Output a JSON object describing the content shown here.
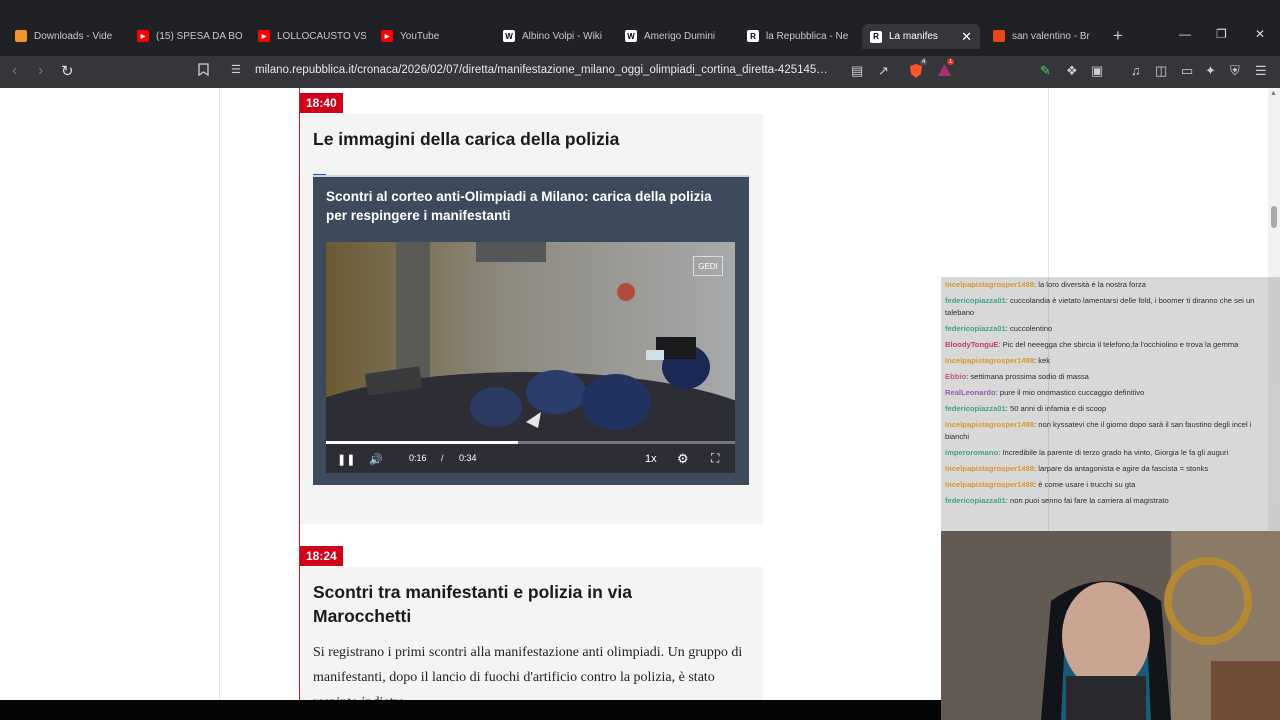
{
  "tabs": [
    {
      "title": "Downloads - Vide",
      "icon": "brave-icon",
      "color": "#f0932b"
    },
    {
      "title": "(15) SPESA DA BO",
      "icon": "youtube-icon",
      "color": "#ff0000"
    },
    {
      "title": "LOLLOCAUSTO VS",
      "icon": "youtube-icon",
      "color": "#ff0000"
    },
    {
      "title": "YouTube",
      "icon": "youtube-icon",
      "color": "#ff0000"
    },
    {
      "title": "Albino Volpi - Wiki",
      "icon": "wikipedia-icon",
      "color": "#ffffff"
    },
    {
      "title": "Amerigo Dumini",
      "icon": "wikipedia-icon",
      "color": "#ffffff"
    },
    {
      "title": "la Repubblica - Ne",
      "icon": "repubblica-icon",
      "color": "#ffffff"
    },
    {
      "title": "La manifes",
      "icon": "repubblica-icon",
      "color": "#ffffff",
      "active": true
    },
    {
      "title": "san valentino - Br",
      "icon": "brave-search-icon",
      "color": "#e64a19"
    }
  ],
  "toolbar": {
    "url": "milano.repubblica.it/cronaca/2026/02/07/diretta/manifestazione_milano_oggi_olimpiadi_cortina_diretta-425145…",
    "brave_badge": "4",
    "rewards_badge": "1"
  },
  "posts": [
    {
      "time": "18:40",
      "headline": "Le immagini della carica della polizia",
      "video": {
        "title": "Scontri al corteo anti-Olimpiadi a Milano: carica della polizia per respingere i manifestanti",
        "watermark": "GEDI",
        "current_time": "0:16",
        "separator": "/",
        "duration": "0:34",
        "speed": "1x",
        "progress": 0.47
      }
    },
    {
      "time": "18:24",
      "headline": "Scontri tra manifestanti e polizia in via Marocchetti",
      "body": "Si registrano i primi scontri alla manifestazione anti olimpiadi. Un gruppo di manifestanti, dopo il lancio di fuochi d'artificio contro la polizia, è stato respinto indietro."
    }
  ],
  "chat": [
    {
      "user": "Incelpapistagrosper1488",
      "text": ": la loro diversità è la nostra forza",
      "color": "#d9972f"
    },
    {
      "user": "federicopiazza01",
      "text": ": cuccolandia è vietato lamentarsi delle fold, i boomer ti diranno che sei un talebano",
      "color": "#3aa58e"
    },
    {
      "user": "federicopiazza01",
      "text": ": cuccolentino",
      "color": "#3aa58e"
    },
    {
      "user": "BloodyTonguE",
      "text": ": Pic del neeegga che sbircia il telefono,fa l'occhiolino e trova la gemma",
      "color": "#c0396b"
    },
    {
      "user": "Incelpapistagrosper1488",
      "text": ": kek",
      "color": "#d9972f"
    },
    {
      "user": "Ebbio",
      "text": ": settimana prossima sodio di massa",
      "color": "#c05a7a"
    },
    {
      "user": "RealLeonardo",
      "text": ": pure il mio onomastico cuccaggio definitivo",
      "color": "#9b59b6"
    },
    {
      "user": "federicopiazza01",
      "text": ": 50 anni di infamia e di scoop",
      "color": "#3aa58e"
    },
    {
      "user": "Incelpapistagrosper1488",
      "text": ": non kyssatevi che il giorno dopo sarà il san faustino degli incel i bianchi",
      "color": "#d9972f"
    },
    {
      "user": "imperoromano",
      "text": ": Incredibile la parente di terzo grado ha vinto, Giorgia le fa gli auguri",
      "color": "#3aa58e"
    },
    {
      "user": "Incelpapistagrosper1488",
      "text": ": larpare da antagonista e agire da fascista = stonks",
      "color": "#d9972f"
    },
    {
      "user": "Incelpapistagrosper1488",
      "text": ": è come usare i trucchi su gta",
      "color": "#d9972f"
    },
    {
      "user": "federicopiazza01",
      "text": ": non puoi senno fai fare la carriera al magistrato",
      "color": "#3aa58e"
    }
  ]
}
